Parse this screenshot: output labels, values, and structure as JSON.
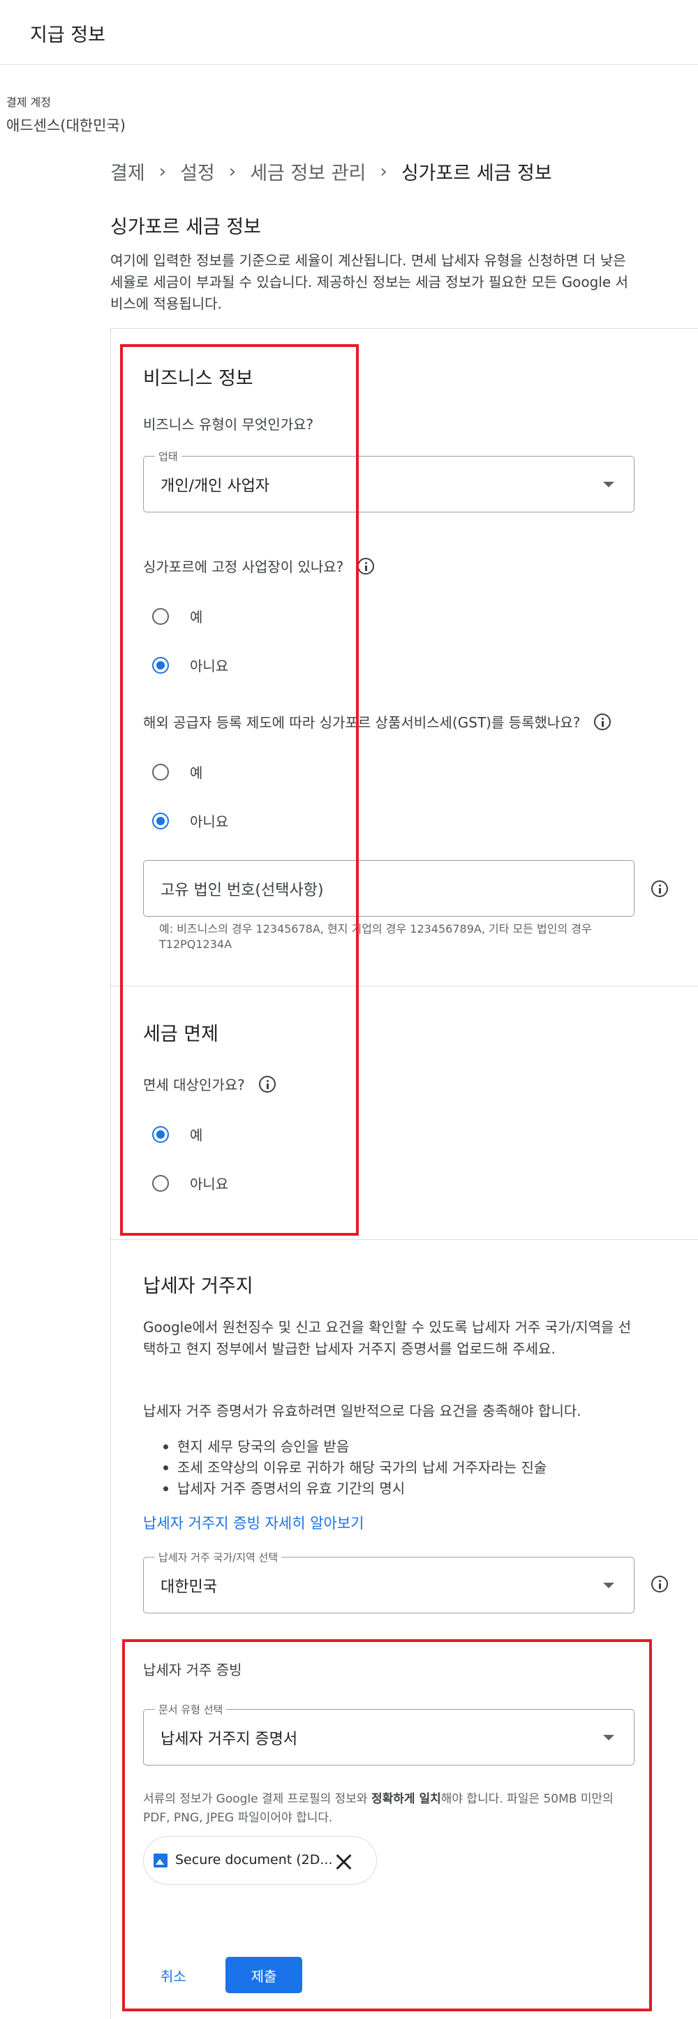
{
  "header": {
    "title": "지급 정보"
  },
  "account": {
    "label": "결제 계정",
    "name": "애드센스(대한민국)"
  },
  "breadcrumb": [
    "결제",
    "설정",
    "세금 정보 관리",
    "싱가포르 세금 정보"
  ],
  "section": {
    "title": "싱가포르 세금 정보",
    "intro": "여기에 입력한 정보를 기준으로 세율이 계산됩니다. 면세 납세자 유형을 신청하면 더 낮은 세율로 세금이 부과될 수 있습니다. 제공하신 정보는 세금 정보가 필요한 모든 Google 서비스에 적용됩니다."
  },
  "business": {
    "heading": "비즈니스 정보",
    "type_question": "비즈니스 유형이 무엇인가요?",
    "type_select": {
      "label": "업태",
      "value": "개인/개인 사업자"
    },
    "fixed_place": {
      "question": "싱가포르에 고정 사업장이 있나요?",
      "options": [
        "예",
        "아니요"
      ],
      "selected": "아니요"
    },
    "gst": {
      "question": "해외 공급자 등록 제도에 따라 싱가포르 상품서비스세(GST)를 등록했나요?",
      "options": [
        "예",
        "아니요"
      ],
      "selected": "아니요"
    },
    "uen": {
      "placeholder": "고유 법인 번호(선택사항)",
      "helper": "예: 비즈니스의 경우 12345678A, 현지 기업의 경우 123456789A, 기타 모든 법인의 경우 T12PQ1234A"
    }
  },
  "exemption": {
    "heading": "세금 면제",
    "question": "면세 대상인가요?",
    "options": [
      "예",
      "아니요"
    ],
    "selected": "예"
  },
  "residency": {
    "heading": "납세자 거주지",
    "para1": "Google에서 원천징수 및 신고 요건을 확인할 수 있도록 납세자 거주 국가/지역을 선택하고 현지 정부에서 발급한 납세자 거주지 증명서를 업로드해 주세요.",
    "para2": "납세자 거주 증명서가 유효하려면 일반적으로 다음 요건을 충족해야 합니다.",
    "bullets": [
      "현지 세무 당국의 승인을 받음",
      "조세 조약상의 이유로 귀하가 해당 국가의 납세 거주자라는 진술",
      "납세자 거주 증명서의 유효 기간의 명시"
    ],
    "link": "납세자 거주지 증빙 자세히 알아보기",
    "country_select": {
      "label": "납세자 거주 국가/지역 선택",
      "value": "대한민국"
    }
  },
  "proof": {
    "heading": "납세자 거주 증빙",
    "doc_select": {
      "label": "문서 유형 선택",
      "value": "납세자 거주지 증명서"
    },
    "note_pre": "서류의 정보가 Google 결제 프로필의 정보와 ",
    "note_bold": "정확하게 일치",
    "note_post": "해야 합니다. 파일은 50MB 미만의 PDF, PNG, JPEG 파일이어야 합니다.",
    "file_name": "Secure document (2D...",
    "cancel_label": "취소",
    "submit_label": "제출"
  },
  "colors": {
    "accent": "#1a73e8",
    "highlight": "#e51b24"
  }
}
